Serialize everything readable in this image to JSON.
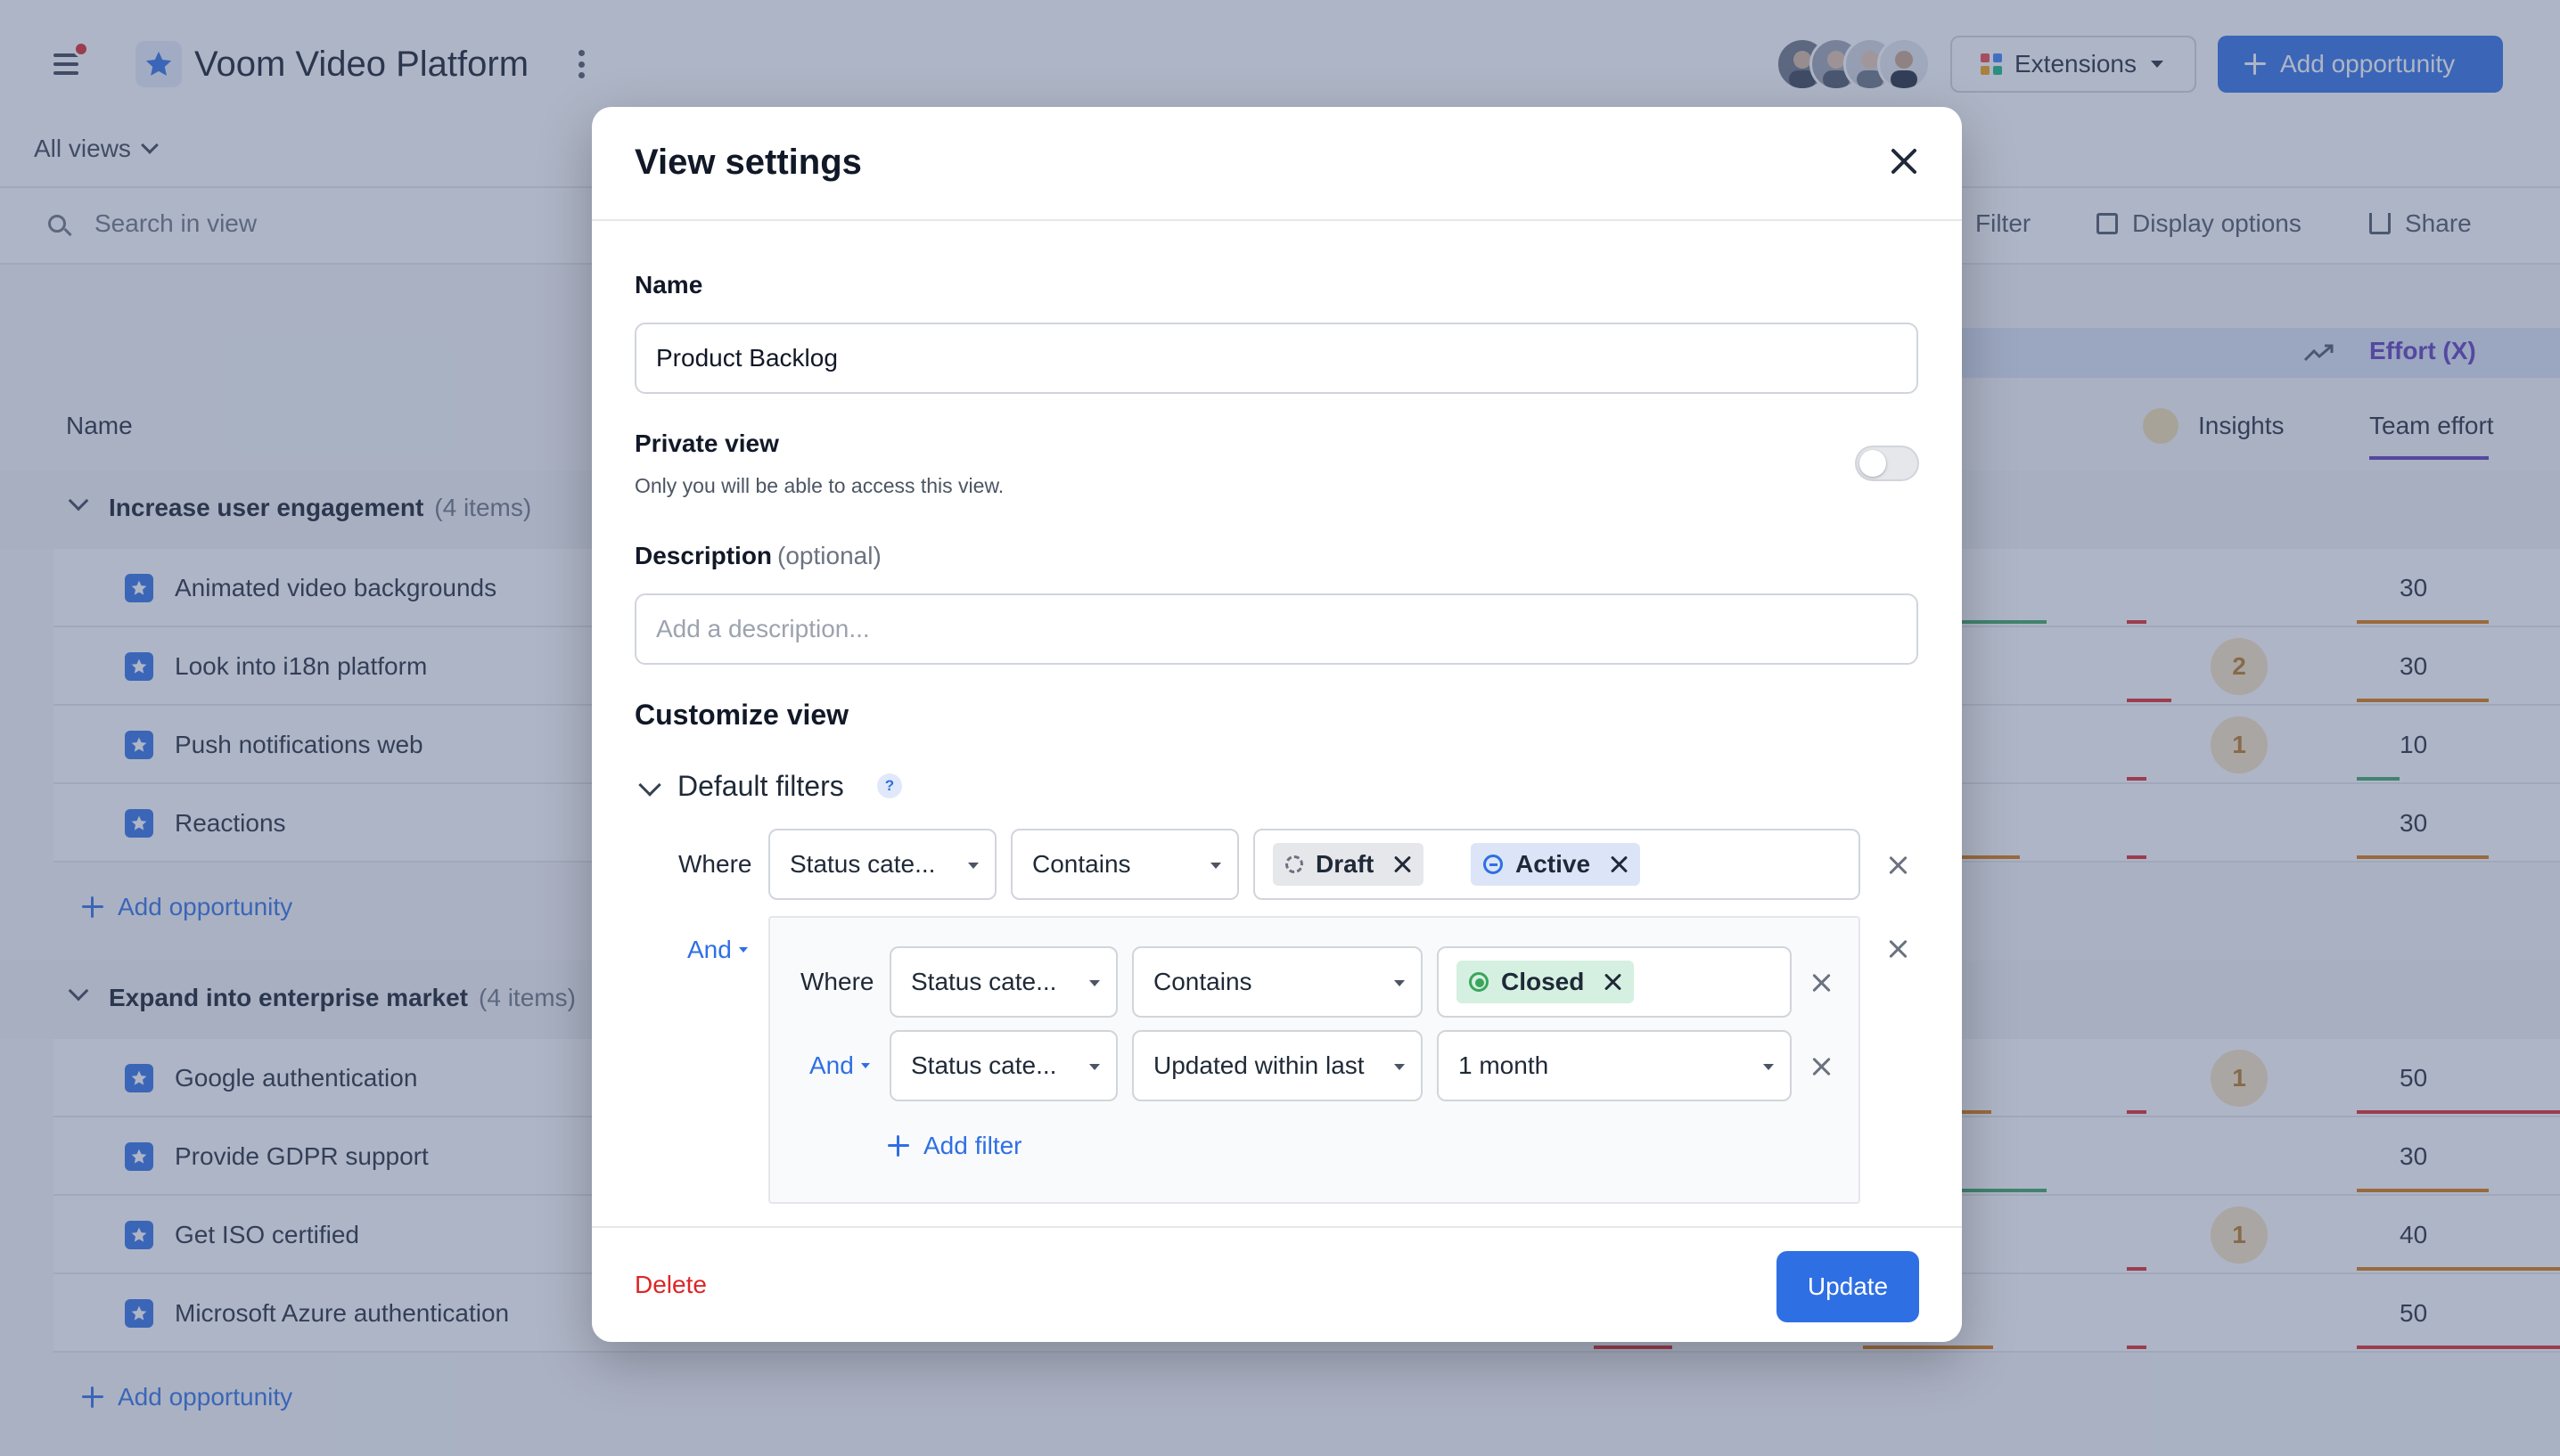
{
  "app": {
    "title": "Voom Video Platform",
    "extensions_label": "Extensions",
    "add_opportunity_label": "Add opportunity",
    "all_views_label": "All views",
    "search_placeholder": "Search in view",
    "toolbar": {
      "filter": "Filter",
      "display_options": "Display options",
      "share": "Share"
    },
    "colors": {
      "accent": "#2f6fe4",
      "danger": "#dc2626"
    }
  },
  "table": {
    "name_header": "Name",
    "effort_group_header": "Effort (X)",
    "insights_header": "Insights",
    "team_effort_header": "Team effort",
    "add_opportunity_row": "Add opportunity",
    "groups": [
      {
        "title": "Increase user engagement",
        "count": "(4 items)",
        "items": [
          {
            "name": "Animated video backgrounds",
            "insights": "",
            "effort": "30"
          },
          {
            "name": "Look into i18n platform",
            "insights": "2",
            "effort": "30"
          },
          {
            "name": "Push notifications web",
            "insights": "1",
            "effort": "10"
          },
          {
            "name": "Reactions",
            "insights": "",
            "effort": "30"
          }
        ]
      },
      {
        "title": "Expand into enterprise market",
        "count": "(4 items)",
        "items": [
          {
            "name": "Google authentication",
            "insights": "1",
            "effort": "50"
          },
          {
            "name": "Provide GDPR support",
            "insights": "",
            "effort": "30"
          },
          {
            "name": "Get ISO certified",
            "insights": "1",
            "effort": "40"
          },
          {
            "name": "Microsoft Azure authentication",
            "insights": "",
            "effort": "50"
          }
        ]
      }
    ]
  },
  "modal": {
    "title": "View settings",
    "name_label": "Name",
    "name_value": "Product Backlog",
    "private_label": "Private view",
    "private_help": "Only you will be able to access this view.",
    "private_enabled": false,
    "description_label": "Description",
    "description_optional": "(optional)",
    "description_placeholder": "Add a description...",
    "customize_title": "Customize view",
    "default_filters_title": "Default filters",
    "help_mark": "?",
    "filters": {
      "where": "Where",
      "and": "And",
      "row1": {
        "field": "Status cate...",
        "operator": "Contains",
        "chips": [
          {
            "label": "Draft",
            "color": "#e5e7eb"
          },
          {
            "label": "Active",
            "color": "#dbe5f7"
          }
        ]
      },
      "nested": {
        "row1": {
          "field": "Status cate...",
          "operator": "Contains",
          "chips": [
            {
              "label": "Closed",
              "color": "#d5f0e0"
            }
          ]
        },
        "row2": {
          "field": "Status cate...",
          "operator": "Updated within last",
          "value": "1 month"
        },
        "add_filter": "Add filter"
      }
    },
    "delete_label": "Delete",
    "update_label": "Update"
  }
}
